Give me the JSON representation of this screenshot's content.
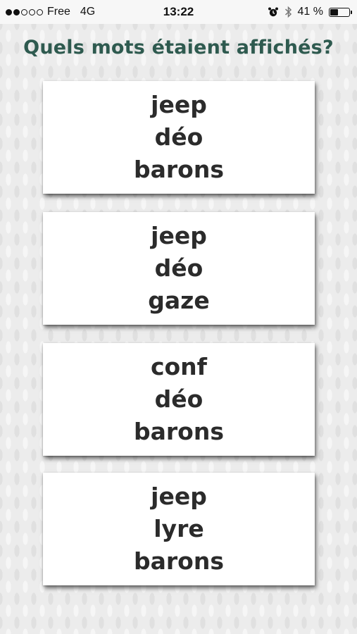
{
  "status_bar": {
    "carrier": "Free",
    "network": "4G",
    "time": "13:22",
    "battery_text": "41 %",
    "battery_level": 0.41,
    "signal_bars_filled": 2,
    "signal_bars_total": 5,
    "icons": [
      "alarm-icon",
      "bluetooth-icon",
      "battery-icon"
    ]
  },
  "question": "Quels mots étaient affichés?",
  "options": [
    {
      "words": [
        "jeep",
        "déo",
        "barons"
      ]
    },
    {
      "words": [
        "jeep",
        "déo",
        "gaze"
      ]
    },
    {
      "words": [
        "conf",
        "déo",
        "barons"
      ]
    },
    {
      "words": [
        "jeep",
        "lyre",
        "barons"
      ]
    }
  ],
  "colors": {
    "question_text": "#2e5a4f",
    "card_text": "#2b2b2b",
    "card_background": "#ffffff",
    "page_background": "#ececec"
  }
}
